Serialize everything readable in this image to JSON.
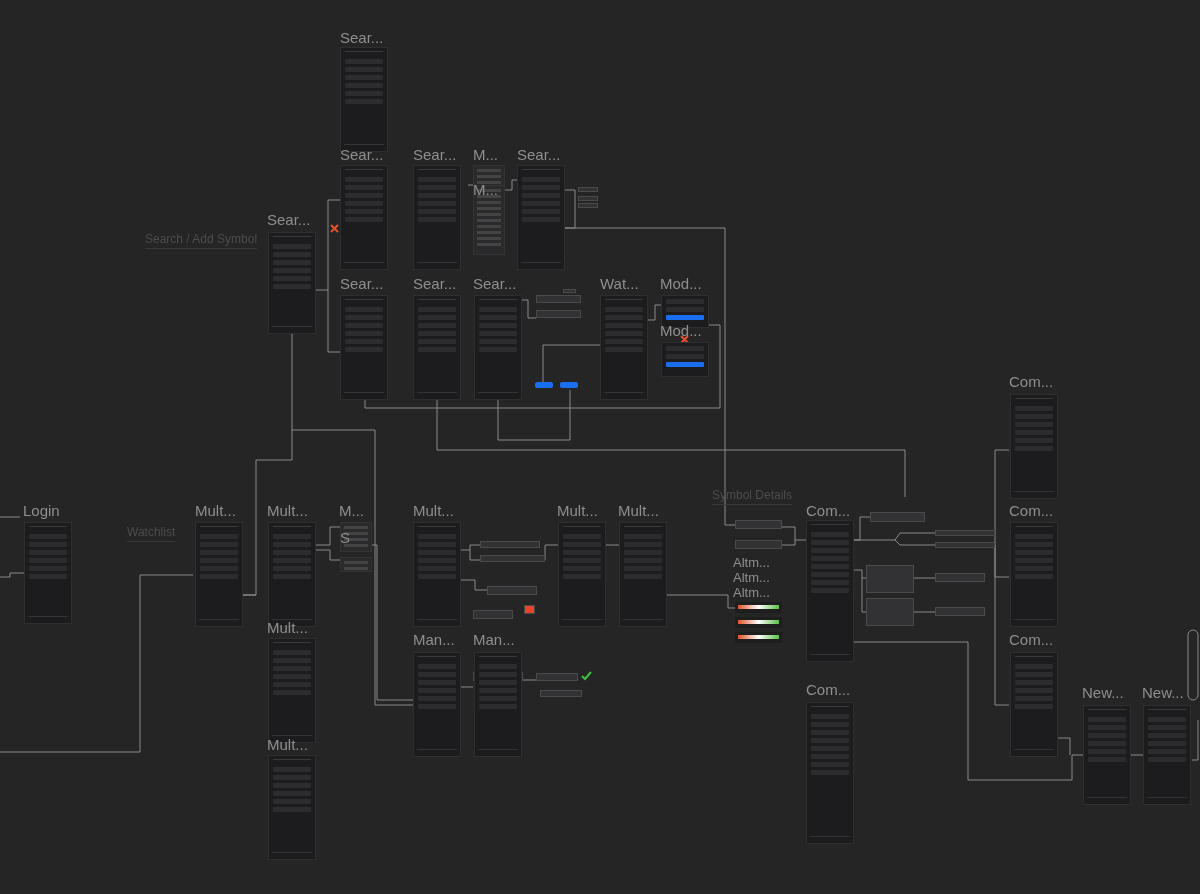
{
  "section_labels": [
    {
      "text": "Search / Add Symbol"
    },
    {
      "text": "Watchlist"
    },
    {
      "text": "Symbol Details"
    }
  ],
  "frames": [
    {
      "title": "Sear...",
      "kind": "screen"
    },
    {
      "title": "Sear...",
      "kind": "screen"
    },
    {
      "title": "Sear...",
      "kind": "screen"
    },
    {
      "title": "Sear...",
      "kind": "screen"
    },
    {
      "title": "M...",
      "kind": "menu"
    },
    {
      "title": "M...",
      "kind": "menu"
    },
    {
      "title": "Sear...",
      "kind": "screen"
    },
    {
      "title": "Sear...",
      "kind": "screen"
    },
    {
      "title": "Sear...",
      "kind": "screen"
    },
    {
      "title": "Sear...",
      "kind": "screen"
    },
    {
      "title": "Wat...",
      "kind": "screen"
    },
    {
      "title": "Mod...",
      "kind": "modal"
    },
    {
      "title": "Mod...",
      "kind": "modal"
    },
    {
      "title": "Login",
      "kind": "screen"
    },
    {
      "title": "Mult...",
      "kind": "screen"
    },
    {
      "title": "Mult...",
      "kind": "screen"
    },
    {
      "title": "M...",
      "kind": "menu"
    },
    {
      "title": "S",
      "kind": "menu"
    },
    {
      "title": "Mult...",
      "kind": "screen"
    },
    {
      "title": "Mult...",
      "kind": "screen"
    },
    {
      "title": "Mult...",
      "kind": "screen"
    },
    {
      "title": "Mult...",
      "kind": "screen"
    },
    {
      "title": "Mult...",
      "kind": "screen"
    },
    {
      "title": "Man...",
      "kind": "screen"
    },
    {
      "title": "Man...",
      "kind": "screen"
    },
    {
      "title": "Com...",
      "kind": "screen"
    },
    {
      "title": "Altm...",
      "kind": "card"
    },
    {
      "title": "Altm...",
      "kind": "card"
    },
    {
      "title": "Altm...",
      "kind": "card"
    },
    {
      "title": "Com...",
      "kind": "screen"
    },
    {
      "title": "Com...",
      "kind": "screen"
    },
    {
      "title": "Com...",
      "kind": "screen"
    },
    {
      "title": "Com...",
      "kind": "screen"
    },
    {
      "title": "New...",
      "kind": "screen"
    },
    {
      "title": "New...",
      "kind": "screen"
    }
  ]
}
